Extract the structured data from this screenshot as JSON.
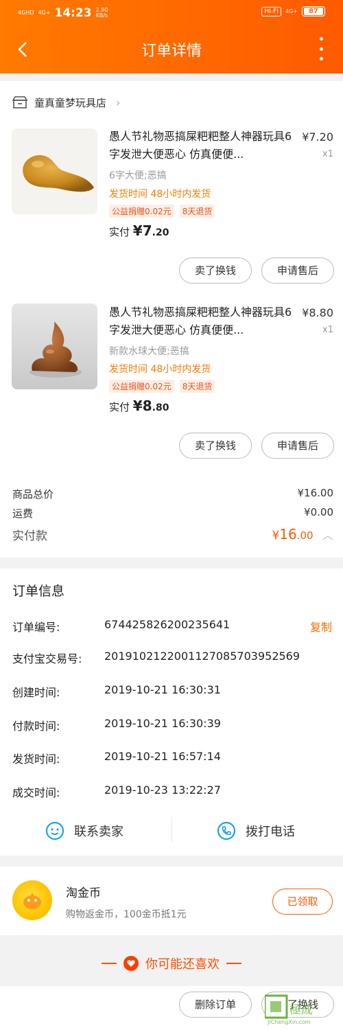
{
  "statusbar": {
    "net1": "4GHD",
    "net2": "4G+",
    "time": "14:23",
    "speed": "2.90",
    "speed_unit": "KB/s",
    "wifi": "HI-FI",
    "signal": "4G+",
    "battery": "87"
  },
  "header": {
    "title": "订单详情"
  },
  "store": {
    "name": "童真童梦玩具店"
  },
  "items": [
    {
      "title": "愚人节礼物恶搞屎粑粑整人神器玩具6字发泄大便恶心 仿真便便...",
      "price": "¥7.20",
      "qty": "x1",
      "sku": "6字大便;恶搞",
      "ship": "发货时间 48小时内发货",
      "tags": [
        "公益捐赠0.02元",
        "8天退货"
      ],
      "paid_label": "实付",
      "paid_symbol": "¥",
      "paid_int": "7",
      "paid_dec": ".20",
      "btn_sell": "卖了换钱",
      "btn_after": "申请售后",
      "image": "poop-6-shape"
    },
    {
      "title": "愚人节礼物恶搞屎粑粑整人神器玩具6字发泄大便恶心 仿真便便...",
      "price": "¥8.80",
      "qty": "x1",
      "sku": "新款水球大便;恶搞",
      "ship": "发货时间 48小时内发货",
      "tags": [
        "公益捐赠0.02元",
        "8天退货"
      ],
      "paid_label": "实付",
      "paid_symbol": "¥",
      "paid_int": "8",
      "paid_dec": ".80",
      "btn_sell": "卖了换钱",
      "btn_after": "申请售后",
      "image": "poop-swirl"
    }
  ],
  "summary": {
    "goods_label": "商品总价",
    "goods_value": "¥16.00",
    "freight_label": "运费",
    "freight_value": "¥0.00",
    "total_label": "实付款",
    "total_symbol": "¥",
    "total_int": "16",
    "total_dec": ".00"
  },
  "order_info": {
    "title": "订单信息",
    "rows": [
      {
        "label": "订单编号:",
        "value": "674425826200235641"
      },
      {
        "label": "支付宝交易号:",
        "value": "2019102122001127085703952569"
      },
      {
        "label": "创建时间:",
        "value": "2019-10-21 16:30:31"
      },
      {
        "label": "付款时间:",
        "value": "2019-10-21 16:30:39"
      },
      {
        "label": "发货时间:",
        "value": "2019-10-21 16:57:14"
      },
      {
        "label": "成交时间:",
        "value": "2019-10-23 13:22:27"
      }
    ],
    "copy_label": "复制"
  },
  "contact": {
    "seller": "联系卖家",
    "call": "拨打电话"
  },
  "coins": {
    "title": "淘金币",
    "desc": "购物返金币，100金币抵1元",
    "button": "已领取"
  },
  "recommend": {
    "label": "你可能还喜欢"
  },
  "bottom": {
    "delete": "删除订单",
    "sell": "卖了换钱"
  },
  "watermark": {
    "text": "JiChengXin.com"
  },
  "colors": {
    "brand": "#ff6a00",
    "price": "#ff5a00"
  }
}
